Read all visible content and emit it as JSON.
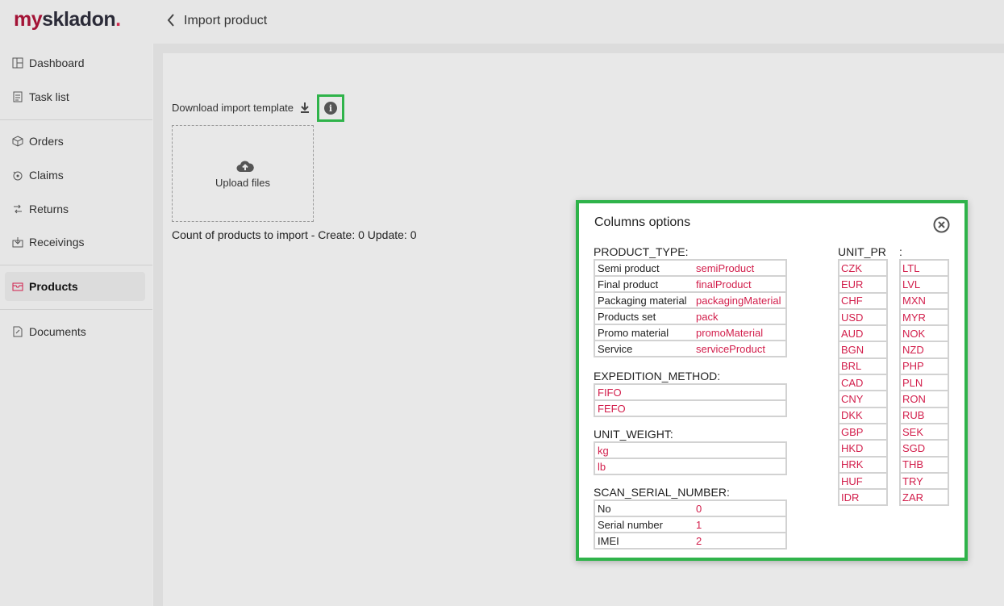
{
  "brand": {
    "logo_part1": "my",
    "logo_part2": "skladon",
    "logo_dot": "."
  },
  "header": {
    "title": "Import product"
  },
  "sidebar": {
    "items": [
      {
        "label": "Dashboard",
        "icon": "dashboard-icon"
      },
      {
        "label": "Task list",
        "icon": "task-list-icon"
      },
      {
        "label": "Orders",
        "icon": "box-icon"
      },
      {
        "label": "Claims",
        "icon": "claims-icon"
      },
      {
        "label": "Returns",
        "icon": "returns-icon"
      },
      {
        "label": "Receivings",
        "icon": "receivings-icon"
      },
      {
        "label": "Products",
        "icon": "products-icon",
        "active": true
      },
      {
        "label": "Documents",
        "icon": "documents-icon"
      }
    ]
  },
  "main": {
    "download_label": "Download import template",
    "upload_label": "Upload files",
    "count_text": "Count of products to import - Create: 0 Update: 0"
  },
  "popup": {
    "title": "Columns options",
    "product_type": {
      "label": "PRODUCT_TYPE:",
      "rows": [
        {
          "name": "Semi product",
          "value": "semiProduct"
        },
        {
          "name": "Final product",
          "value": "finalProduct"
        },
        {
          "name": "Packaging material",
          "value": "packagingMaterial"
        },
        {
          "name": "Products set",
          "value": "pack"
        },
        {
          "name": "Promo material",
          "value": "promoMaterial"
        },
        {
          "name": "Service",
          "value": "serviceProduct"
        }
      ]
    },
    "expedition_method": {
      "label": "EXPEDITION_METHOD:",
      "values": [
        "FIFO",
        "FEFO"
      ]
    },
    "unit_weight": {
      "label": "UNIT_WEIGHT:",
      "values": [
        "kg",
        "lb"
      ]
    },
    "scan_serial_number": {
      "label": "SCAN_SERIAL_NUMBER:",
      "rows": [
        {
          "name": "No",
          "value": "0"
        },
        {
          "name": "Serial number",
          "value": "1"
        },
        {
          "name": "IMEI",
          "value": "2"
        }
      ]
    },
    "unit_price": {
      "label_part1": "UNIT_PR",
      "label_part2": ":",
      "col1": [
        "CZK",
        "EUR",
        "CHF",
        "USD",
        "AUD",
        "BGN",
        "BRL",
        "CAD",
        "CNY",
        "DKK",
        "GBP",
        "HKD",
        "HRK",
        "HUF",
        "IDR"
      ],
      "col2": [
        "LTL",
        "LVL",
        "MXN",
        "MYR",
        "NOK",
        "NZD",
        "PHP",
        "PLN",
        "RON",
        "RUB",
        "SEK",
        "SGD",
        "THB",
        "TRY",
        "ZAR"
      ]
    }
  },
  "colors": {
    "accent": "#d21e4b",
    "highlight": "#2fb34a",
    "brand_red": "#a31336",
    "brand_dark": "#2b2b38"
  }
}
